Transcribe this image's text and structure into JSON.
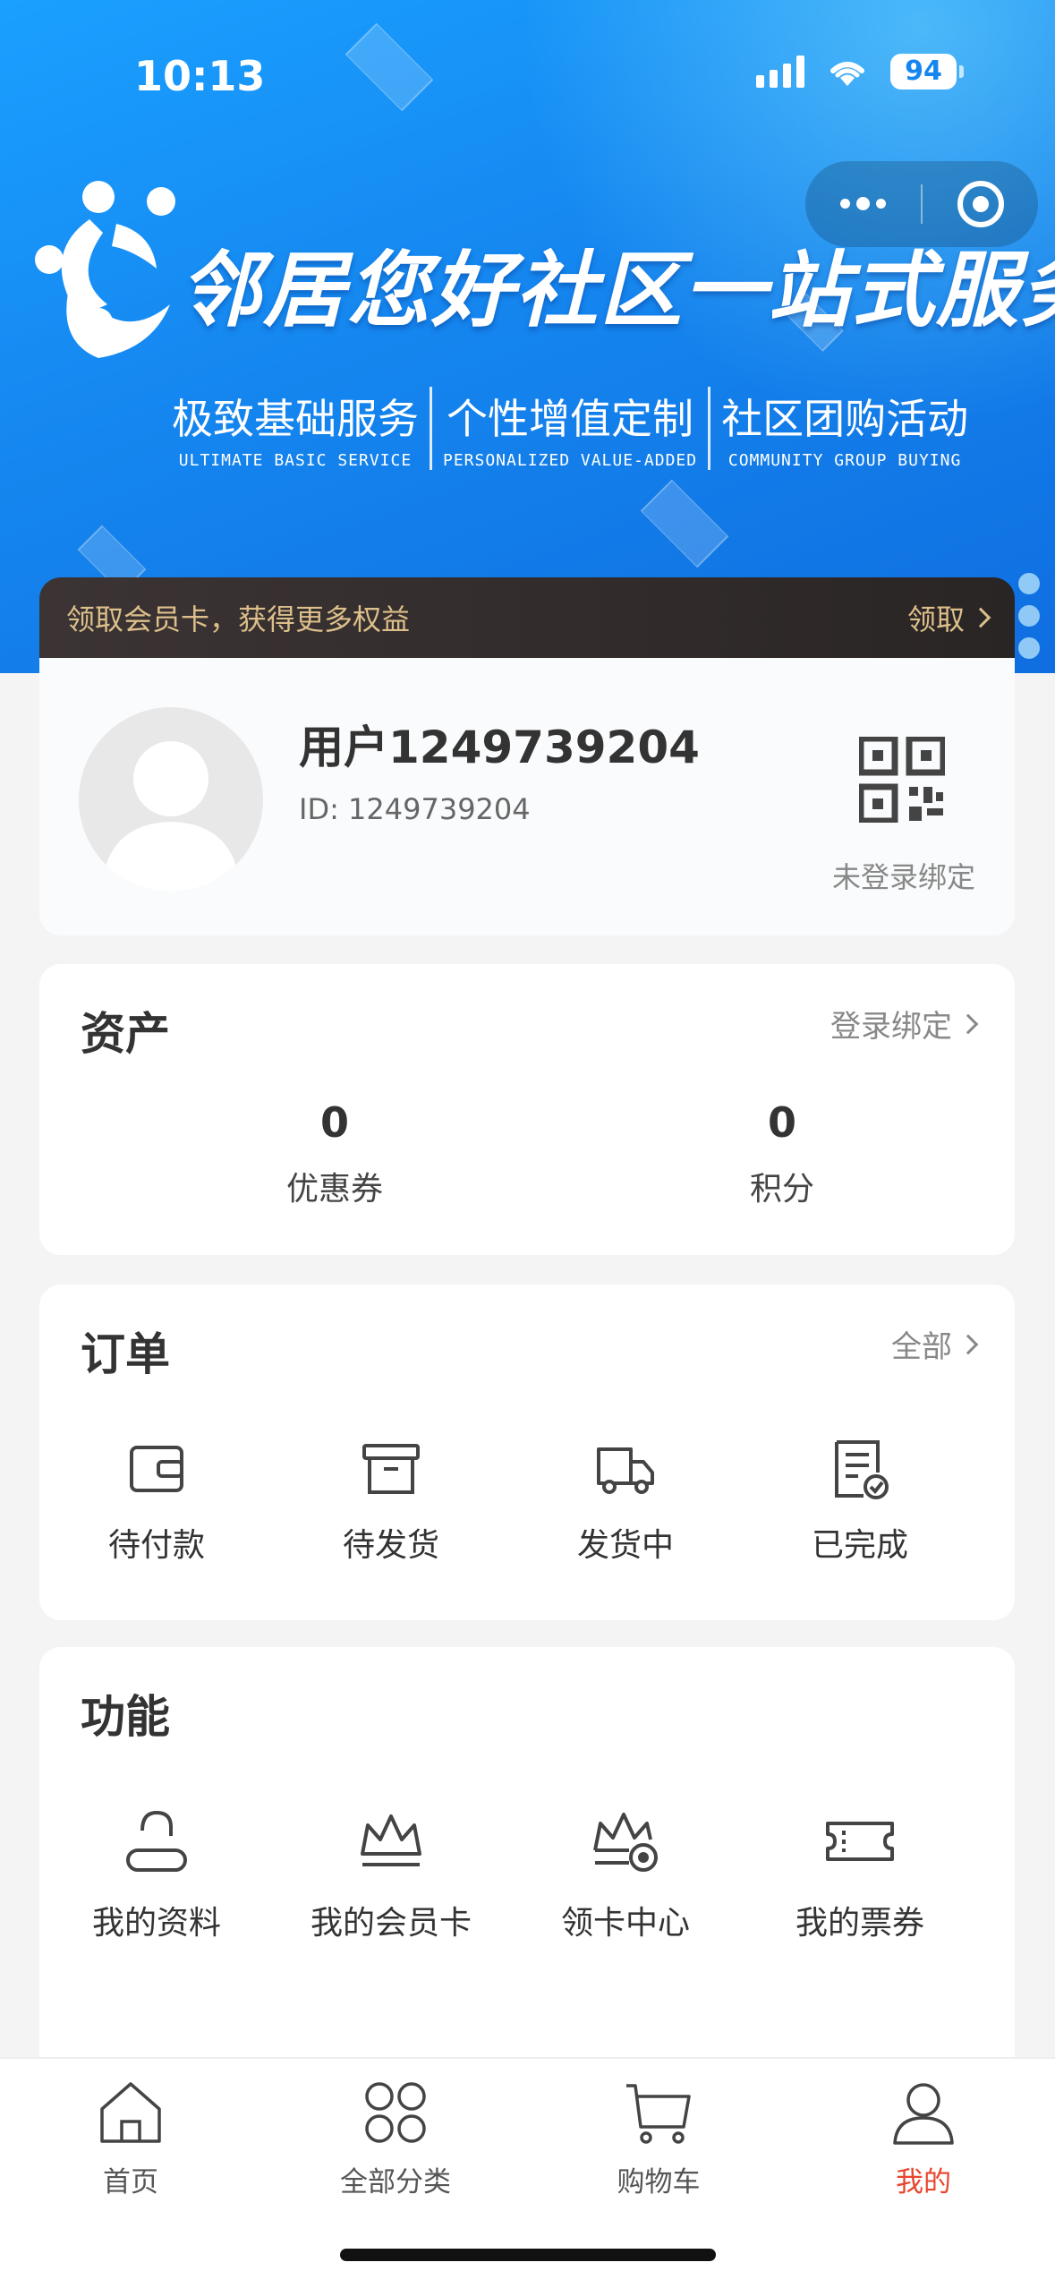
{
  "status_bar": {
    "time": "10:13",
    "battery": "94"
  },
  "banner": {
    "slogan": "邻居您好社区一站式服务",
    "sub_slogans": [
      {
        "zh": "极致基础服务",
        "en": "ULTIMATE BASIC SERVICE"
      },
      {
        "zh": "个性增值定制",
        "en": "PERSONALIZED VALUE-ADDED"
      },
      {
        "zh": "社区团购活动",
        "en": "COMMUNITY GROUP BUYING"
      }
    ]
  },
  "member_bar": {
    "text": "领取会员卡，获得更多权益",
    "action": "领取"
  },
  "profile": {
    "username": "用户1249739204",
    "user_id": "ID: 1249739204",
    "qr_label": "未登录绑定"
  },
  "assets": {
    "title": "资产",
    "link": "登录绑定",
    "items": [
      {
        "value": "0",
        "label": "优惠券"
      },
      {
        "value": "0",
        "label": "积分"
      }
    ]
  },
  "orders": {
    "title": "订单",
    "link": "全部",
    "items": [
      {
        "label": "待付款",
        "icon": "wallet-icon"
      },
      {
        "label": "待发货",
        "icon": "box-icon"
      },
      {
        "label": "发货中",
        "icon": "truck-icon"
      },
      {
        "label": "已完成",
        "icon": "completed-doc-icon"
      }
    ]
  },
  "functions": {
    "title": "功能",
    "items": [
      {
        "label": "我的资料",
        "icon": "profile-icon"
      },
      {
        "label": "我的会员卡",
        "icon": "crown-icon"
      },
      {
        "label": "领卡中心",
        "icon": "crown-badge-icon"
      },
      {
        "label": "我的票券",
        "icon": "ticket-icon"
      }
    ]
  },
  "tabbar": {
    "items": [
      {
        "label": "首页",
        "icon": "home-icon"
      },
      {
        "label": "全部分类",
        "icon": "categories-icon"
      },
      {
        "label": "购物车",
        "icon": "cart-icon"
      },
      {
        "label": "我的",
        "icon": "user-icon"
      }
    ],
    "active_color": "#e8452e"
  },
  "colors": {
    "banner_blue": "#1586ef",
    "member_gold": "#dcbf8a",
    "active_red": "#e8452e"
  }
}
